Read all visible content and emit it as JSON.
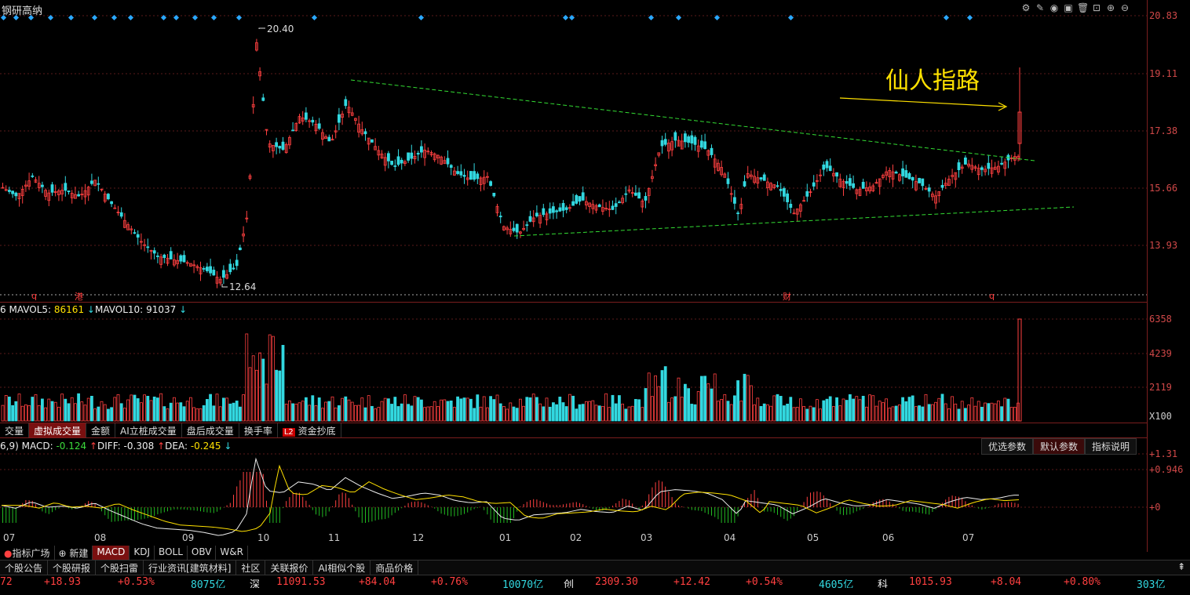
{
  "stock_name": "钢研高纳",
  "annotation": "仙人指路",
  "price_axis": [
    "20.83",
    "19.11",
    "17.38",
    "15.66",
    "13.93"
  ],
  "price_high_label": "20.40",
  "price_low_label": "12.64",
  "event_markers": [
    "q",
    "港",
    "财",
    "q"
  ],
  "volume": {
    "header_prefix": "6",
    "mavol5_label": "MAVOL5:",
    "mavol5_value": "86161",
    "mavol10_label": "MAVOL10:",
    "mavol10_value": "91037",
    "axis": [
      "6358",
      "4239",
      "2119",
      "X100"
    ]
  },
  "volume_tabs": [
    "交量",
    "虚拟成交量",
    "金额",
    "AI立桩成交量",
    "盘后成交量",
    "换手率",
    "资金抄底"
  ],
  "volume_tabs_l2": "L2",
  "macd": {
    "header_prefix": "6,9)",
    "macd_label": "MACD:",
    "macd_value": "-0.124",
    "diff_label": "DIFF:",
    "diff_value": "-0.308",
    "dea_label": "DEA:",
    "dea_value": "-0.245",
    "axis": [
      "1.31",
      "0.946",
      "0"
    ]
  },
  "param_buttons": [
    "优选参数",
    "默认参数",
    "指标说明"
  ],
  "months": [
    "07",
    "08",
    "09",
    "10",
    "11",
    "12",
    "01",
    "02",
    "03",
    "04",
    "05",
    "06",
    "07"
  ],
  "indicator_tabs": [
    "指标广场",
    "新建",
    "MACD",
    "KDJ",
    "BOLL",
    "OBV",
    "W&R"
  ],
  "news_tabs": [
    "个股公告",
    "个股研报",
    "个股扫雷",
    "行业资讯[建筑材料]",
    "社区",
    "关联报价",
    "AI相似个股",
    "商品价格"
  ],
  "ticker": {
    "idx1_prefix": "72",
    "idx1_change": "+18.93",
    "idx1_pct": "+0.53%",
    "idx1_amount": "8075亿",
    "idx2_name": "深",
    "idx2_value": "11091.53",
    "idx2_change": "+84.04",
    "idx2_pct": "+0.76%",
    "idx2_amount": "10070亿",
    "idx3_name": "创",
    "idx3_value": "2309.30",
    "idx3_change": "+12.42",
    "idx3_pct": "+0.54%",
    "idx3_amount": "4605亿",
    "idx4_name": "科",
    "idx4_value": "1015.93",
    "idx4_change": "+8.04",
    "idx4_pct": "+0.80%",
    "idx4_amount": "303亿"
  },
  "colors": {
    "up": "#ff4040",
    "down": "#32d8e0",
    "trend": "#33dd33",
    "annotation": "#ffe100"
  }
}
